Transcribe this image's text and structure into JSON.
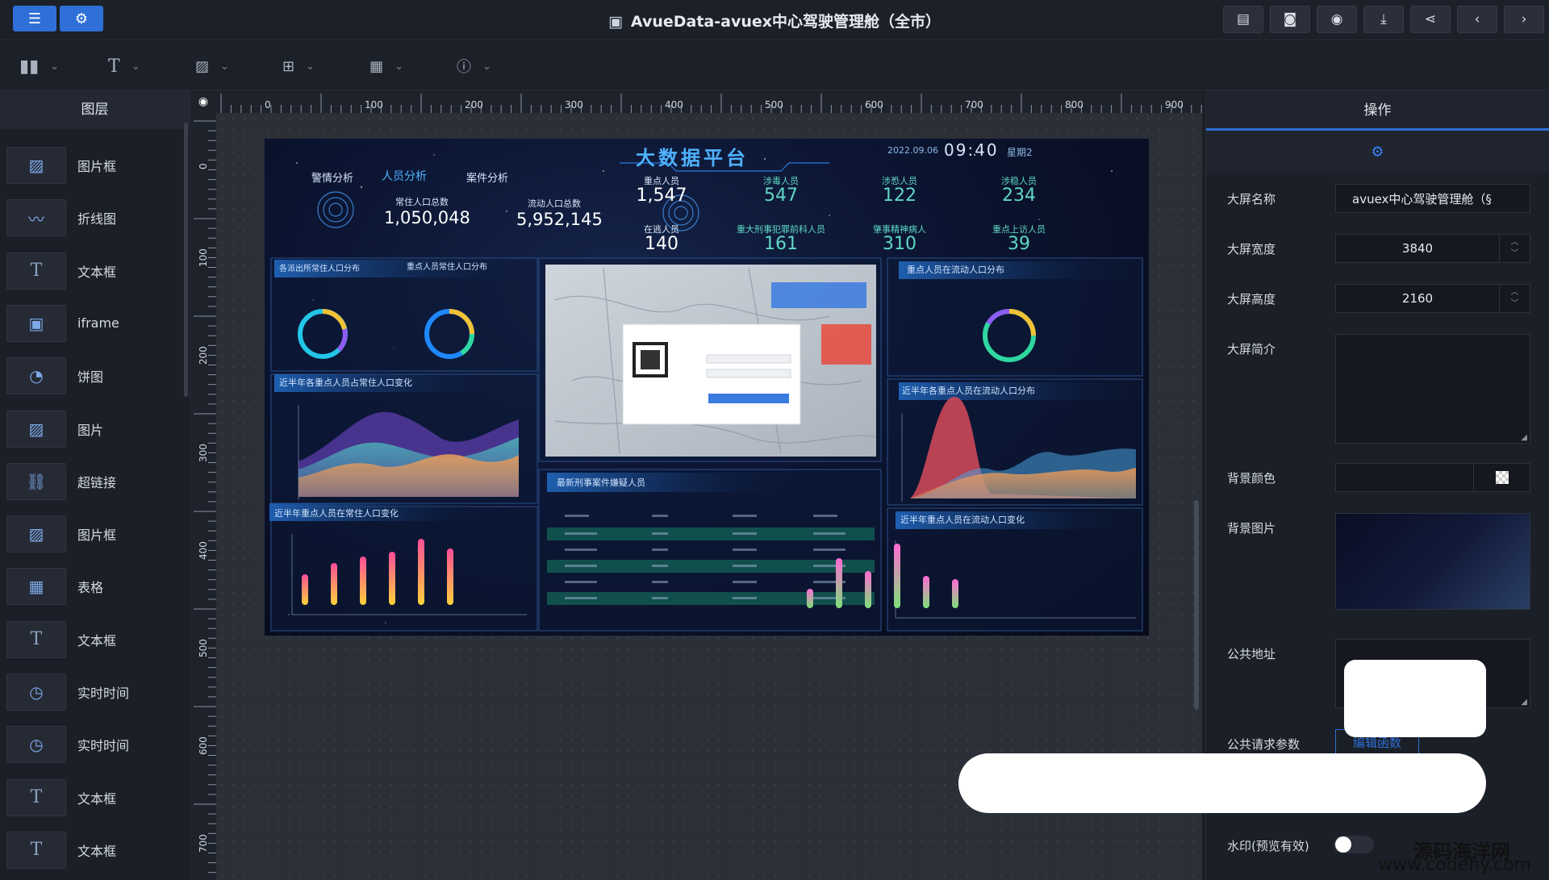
{
  "window": {
    "title": "AvueData-avuex中心驾驶管理舱（全市）"
  },
  "left_panel": {
    "header": "图层",
    "items": [
      {
        "label": "图片框",
        "icon": "image-icon"
      },
      {
        "label": "折线图",
        "icon": "line-chart-icon"
      },
      {
        "label": "文本框",
        "icon": "text-icon"
      },
      {
        "label": "iframe",
        "icon": "iframe-icon"
      },
      {
        "label": "饼图",
        "icon": "pie-chart-icon"
      },
      {
        "label": "图片",
        "icon": "image-icon"
      },
      {
        "label": "超链接",
        "icon": "link-icon"
      },
      {
        "label": "图片框",
        "icon": "image-icon"
      },
      {
        "label": "表格",
        "icon": "table-icon"
      },
      {
        "label": "文本框",
        "icon": "text-icon"
      },
      {
        "label": "实时时间",
        "icon": "clock-icon"
      },
      {
        "label": "实时时间",
        "icon": "clock-icon"
      },
      {
        "label": "文本框",
        "icon": "text-icon"
      },
      {
        "label": "文本框",
        "icon": "text-icon"
      }
    ]
  },
  "ruler": {
    "h_ticks": [
      "0",
      "100",
      "200",
      "300",
      "400",
      "500",
      "600",
      "700",
      "800",
      "900"
    ],
    "v_ticks": [
      "0",
      "100",
      "200",
      "300",
      "400",
      "500",
      "600",
      "700"
    ]
  },
  "dashboard": {
    "title": "大数据平台",
    "date": "2022.09.06",
    "time": "09:40",
    "weekday": "星期2",
    "tabs": [
      "警情分析",
      "人员分析",
      "案件分析"
    ],
    "resident_total_label": "常住人口总数",
    "resident_total": "1,050,048",
    "floating_total_label": "流动人口总数",
    "floating_total": "5,952,145",
    "stats": [
      {
        "label": "重点人员",
        "value": "1,547"
      },
      {
        "label": "涉毒人员",
        "value": "547"
      },
      {
        "label": "涉恐人员",
        "value": "122"
      },
      {
        "label": "涉稳人员",
        "value": "234"
      },
      {
        "label": "在逃人员",
        "value": "140"
      },
      {
        "label": "重大刑事犯罪前科人员",
        "value": "161"
      },
      {
        "label": "肇事精神病人",
        "value": "310"
      },
      {
        "label": "重点上访人员",
        "value": "39"
      }
    ],
    "panels": {
      "p1a": "各派出所常住人口分布",
      "p1b": "重点人员常住人口分布",
      "p2": "近半年各重点人员占常住人口变化",
      "p3": "近半年重点人员在常住人口变化",
      "p4": "最新刑事案件嫌疑人员",
      "p5": "重点人员在流动人口分布",
      "p6": "近半年各重点人员在流动人口分布",
      "p7": "近半年重点人员在流动人口变化"
    }
  },
  "right_panel": {
    "tab": "操作",
    "name_label": "大屏名称",
    "name_value": "avuex中心驾驶管理舱（§",
    "width_label": "大屏宽度",
    "width_value": "3840",
    "height_label": "大屏高度",
    "height_value": "2160",
    "desc_label": "大屏简介",
    "bg_color_label": "背景颜色",
    "bg_image_label": "背景图片",
    "public_url_label": "公共地址",
    "public_params_label": "公共请求参数",
    "edit_func_label": "编辑函数",
    "watermark_label": "水印(预览有效)"
  },
  "watermark": {
    "line1": "源码海洋网",
    "line2": "www.codehy.com"
  }
}
